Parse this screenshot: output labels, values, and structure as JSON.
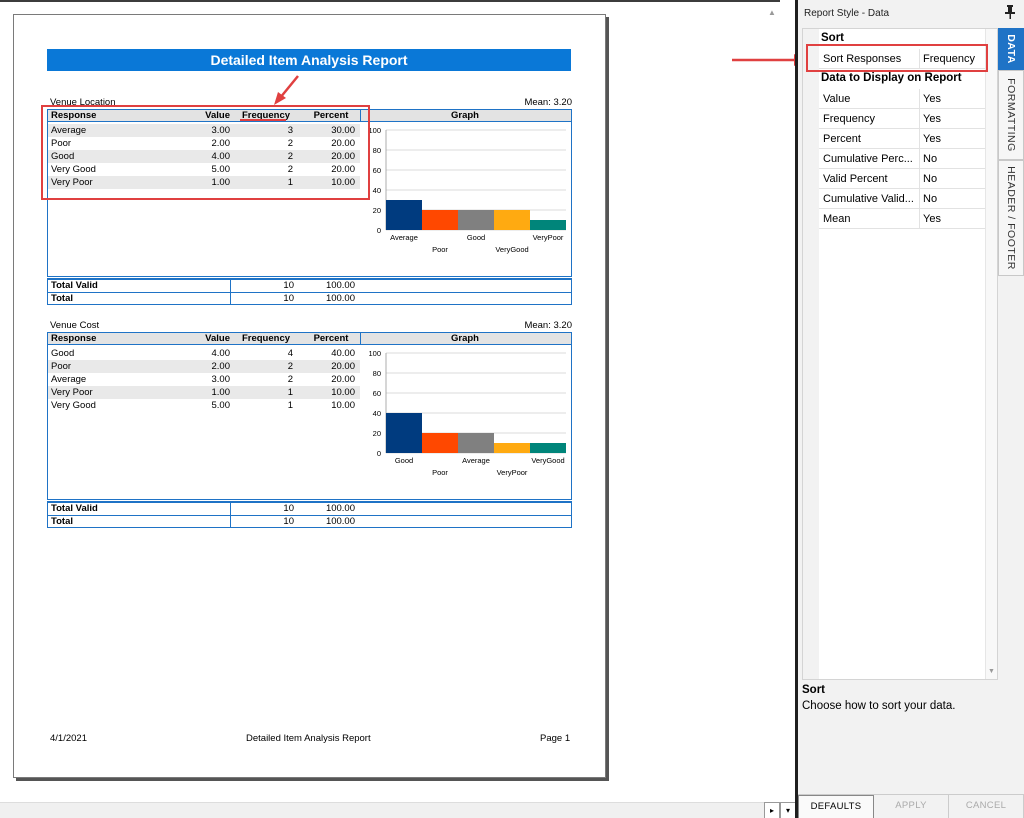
{
  "report": {
    "title": "Detailed Item Analysis Report",
    "footer": {
      "date": "4/1/2021",
      "title": "Detailed Item Analysis Report",
      "page": "Page 1"
    },
    "columns": {
      "response": "Response",
      "value": "Value",
      "frequency": "Frequency",
      "percent": "Percent",
      "graph": "Graph"
    },
    "total_valid_label": "Total Valid",
    "total_label": "Total",
    "sections": [
      {
        "name": "Venue Location",
        "mean": "Mean: 3.20",
        "rows": [
          {
            "response": "Average",
            "value": "3.00",
            "frequency": "3",
            "percent": "30.00"
          },
          {
            "response": "Poor",
            "value": "2.00",
            "frequency": "2",
            "percent": "20.00"
          },
          {
            "response": "Good",
            "value": "4.00",
            "frequency": "2",
            "percent": "20.00"
          },
          {
            "response": "Very Good",
            "value": "5.00",
            "frequency": "2",
            "percent": "20.00"
          },
          {
            "response": "Very Poor",
            "value": "1.00",
            "frequency": "1",
            "percent": "10.00"
          }
        ],
        "total_valid": {
          "frequency": "10",
          "percent": "100.00"
        },
        "total": {
          "frequency": "10",
          "percent": "100.00"
        }
      },
      {
        "name": "Venue Cost",
        "mean": "Mean: 3.20",
        "rows": [
          {
            "response": "Good",
            "value": "4.00",
            "frequency": "4",
            "percent": "40.00"
          },
          {
            "response": "Poor",
            "value": "2.00",
            "frequency": "2",
            "percent": "20.00"
          },
          {
            "response": "Average",
            "value": "3.00",
            "frequency": "2",
            "percent": "20.00"
          },
          {
            "response": "Very Poor",
            "value": "1.00",
            "frequency": "1",
            "percent": "10.00"
          },
          {
            "response": "Very Good",
            "value": "5.00",
            "frequency": "1",
            "percent": "10.00"
          }
        ],
        "total_valid": {
          "frequency": "10",
          "percent": "100.00"
        },
        "total": {
          "frequency": "10",
          "percent": "100.00"
        }
      }
    ]
  },
  "chart_data": [
    {
      "type": "bar",
      "categories": [
        "Average",
        "Poor",
        "Good",
        "VeryGood",
        "VeryPoor"
      ],
      "values": [
        30,
        20,
        20,
        20,
        10
      ],
      "colors": [
        "#003b7f",
        "#ff4800",
        "#808080",
        "#ffaa11",
        "#00857a"
      ],
      "ylim": [
        0,
        100
      ],
      "yticks": [
        "0",
        "20",
        "40",
        "60",
        "80",
        "100"
      ],
      "grid": true
    },
    {
      "type": "bar",
      "categories": [
        "Good",
        "Poor",
        "Average",
        "VeryPoor",
        "VeryGood"
      ],
      "values": [
        40,
        20,
        20,
        10,
        10
      ],
      "colors": [
        "#003b7f",
        "#ff4800",
        "#808080",
        "#ffaa11",
        "#00857a"
      ],
      "ylim": [
        0,
        100
      ],
      "yticks": [
        "0",
        "20",
        "40",
        "60",
        "80",
        "100"
      ],
      "grid": true
    }
  ],
  "panel": {
    "title": "Report Style - Data",
    "categories": {
      "sort": "Sort",
      "display": "Data to Display on Report"
    },
    "sort_rows": [
      {
        "name": "Sort Responses",
        "value": "Frequency"
      }
    ],
    "display_rows": [
      {
        "name": "Value",
        "value": "Yes"
      },
      {
        "name": "Frequency",
        "value": "Yes"
      },
      {
        "name": "Percent",
        "value": "Yes"
      },
      {
        "name": "Cumulative Perc...",
        "value": "No"
      },
      {
        "name": "Valid Percent",
        "value": "No"
      },
      {
        "name": "Cumulative Valid...",
        "value": "No"
      },
      {
        "name": "Mean",
        "value": "Yes"
      }
    ],
    "description": {
      "title": "Sort",
      "text": "Choose how to sort your data."
    },
    "tabs": [
      "DATA",
      "FORMATTING",
      "HEADER / FOOTER"
    ],
    "buttons": {
      "defaults": "DEFAULTS",
      "apply": "APPLY",
      "cancel": "CANCEL"
    }
  },
  "colors": {
    "accent": "#1f73c6",
    "title_bar": "#0a78d7",
    "highlight": "#e04040"
  }
}
